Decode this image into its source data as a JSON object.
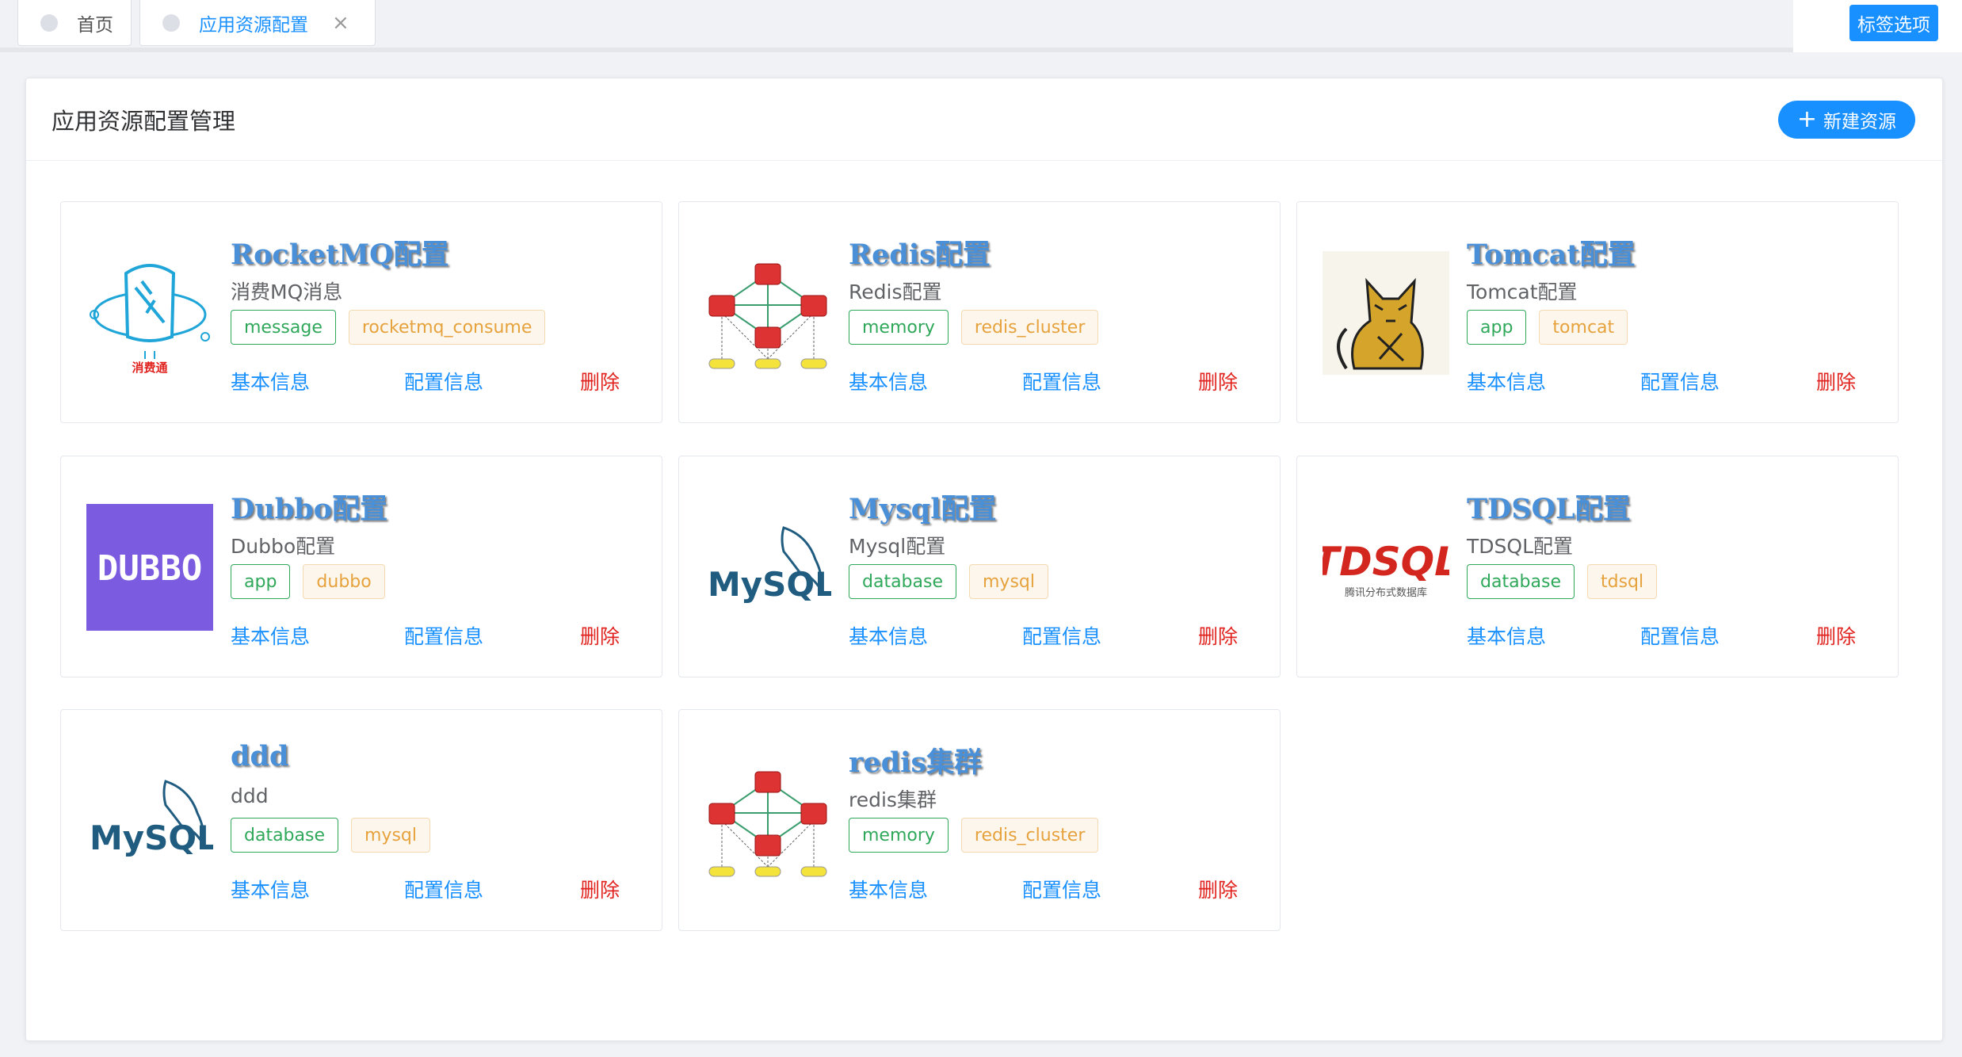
{
  "tabs": [
    {
      "label": "首页",
      "active": false
    },
    {
      "label": "应用资源配置",
      "active": true,
      "closable": true
    }
  ],
  "tab_options_label": "标签选项",
  "page": {
    "title": "应用资源配置管理",
    "new_button": "新建资源"
  },
  "actions": {
    "info": "基本信息",
    "config": "配置信息",
    "delete": "删除"
  },
  "cards": [
    {
      "title": "RocketMQ配置",
      "subtitle": "消费MQ消息",
      "tags": [
        "message",
        "rocketmq_consume"
      ],
      "logo": "rocketmq-logo",
      "logo_caption": "消费通"
    },
    {
      "title": "Redis配置",
      "subtitle": "Redis配置",
      "tags": [
        "memory",
        "redis_cluster"
      ],
      "logo": "redis-cluster-logo"
    },
    {
      "title": "Tomcat配置",
      "subtitle": "Tomcat配置",
      "tags": [
        "app",
        "tomcat"
      ],
      "logo": "tomcat-logo"
    },
    {
      "title": "Dubbo配置",
      "subtitle": "Dubbo配置",
      "tags": [
        "app",
        "dubbo"
      ],
      "logo": "dubbo-logo",
      "logo_caption": "DUBBO"
    },
    {
      "title": "Mysql配置",
      "subtitle": "Mysql配置",
      "tags": [
        "database",
        "mysql"
      ],
      "logo": "mysql-logo",
      "logo_caption": "MySQL"
    },
    {
      "title": "TDSQL配置",
      "subtitle": "TDSQL配置",
      "tags": [
        "database",
        "tdsql"
      ],
      "logo": "tdsql-logo",
      "logo_caption": "TDSQL",
      "logo_subcaption": "腾讯分布式数据库"
    },
    {
      "title": "ddd",
      "subtitle": "ddd",
      "tags": [
        "database",
        "mysql"
      ],
      "logo": "mysql-logo",
      "logo_caption": "MySQL"
    },
    {
      "title": "redis集群",
      "subtitle": "redis集群",
      "tags": [
        "memory",
        "redis_cluster"
      ],
      "logo": "redis-cluster-logo"
    }
  ],
  "colors": {
    "primary": "#1890ff",
    "danger": "#e0231f",
    "tag_green": "#2fa85a",
    "tag_orange": "#e6a23c",
    "title_blue": "#4a90d9"
  }
}
